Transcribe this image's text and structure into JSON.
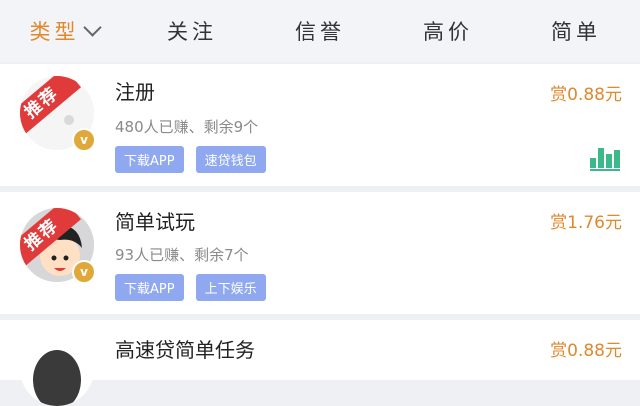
{
  "filters": [
    {
      "label": "类型",
      "active": true
    },
    {
      "label": "关注",
      "active": false
    },
    {
      "label": "信誉",
      "active": false
    },
    {
      "label": "高价",
      "active": false
    },
    {
      "label": "简单",
      "active": false
    }
  ],
  "tasks": [
    {
      "badge": "推荐",
      "title": "注册",
      "meta": "480人已赚、剩余9个",
      "tags": [
        "下载APP",
        "速贷钱包"
      ],
      "reward": "赏0.88元"
    },
    {
      "badge": "推荐",
      "title": "简单试玩",
      "meta": "93人已赚、剩余7个",
      "tags": [
        "下载APP",
        "上下娱乐"
      ],
      "reward": "赏1.76元"
    },
    {
      "badge": "",
      "title": "高速贷简单任务",
      "meta": "",
      "tags": [],
      "reward": "赏0.88元"
    }
  ],
  "icons": {
    "verified": "v-badge-icon",
    "stats": "bar-chart-icon",
    "dropdown": "chevron-down-icon"
  },
  "colors": {
    "accent": "#e0892c",
    "tag": "#8fa8ef",
    "badge": "#e03a3a",
    "stats": "#3bb98a"
  }
}
